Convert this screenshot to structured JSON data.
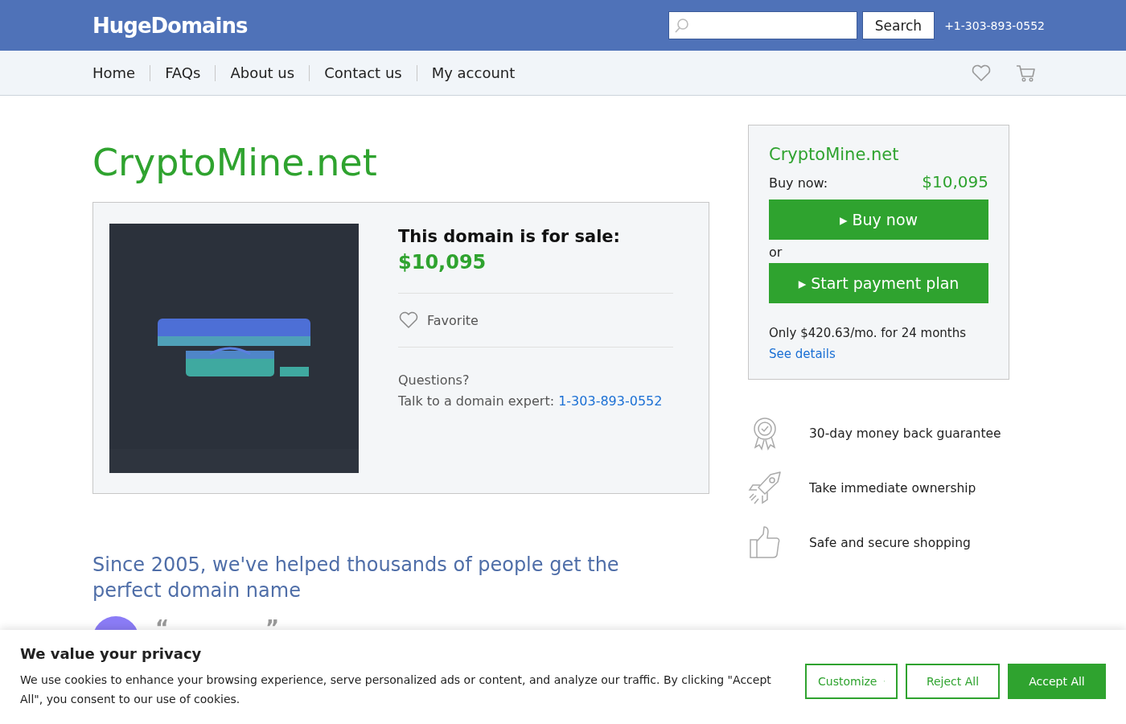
{
  "header": {
    "logo": "HugeDomains",
    "search": {
      "button": "Search"
    },
    "phone": "+1-303-893-0552"
  },
  "nav": {
    "items": [
      {
        "label": "Home"
      },
      {
        "label": "FAQs"
      },
      {
        "label": "About us"
      },
      {
        "label": "Contact us"
      },
      {
        "label": "My account"
      }
    ]
  },
  "domain": {
    "title": "CryptoMine.net",
    "sale_heading": "This domain is for sale:",
    "price": "$10,095",
    "favorite": "Favorite",
    "questions": "Questions?",
    "expert_text": "Talk to a domain expert:",
    "expert_phone": "1-303-893-0552"
  },
  "buy_box": {
    "name": "CryptoMine.net",
    "buy_label": "Buy now:",
    "price": "$10,095",
    "buy_button": "▸ Buy now",
    "or": "or",
    "plan_button": "▸ Start payment plan",
    "plan_text": "Only $420.63/mo. for 24 months",
    "details_link": "See details"
  },
  "features": [
    {
      "kind": "award",
      "text": "30-day money back guarantee"
    },
    {
      "kind": "rocket",
      "text": "Take immediate ownership"
    },
    {
      "kind": "thumb",
      "text": "Safe and secure shopping"
    }
  ],
  "testimonials": {
    "heading": "Since 2005, we've helped thousands of people get the perfect domain name",
    "first": {
      "open_quote": "“",
      "close_quote": "”"
    }
  },
  "cookie_banner": {
    "title": "We value your privacy",
    "text": "We use cookies to enhance your browsing experience, serve personalized ads or content, and analyze our traffic. By clicking \"Accept All\", you consent to our use of cookies.",
    "buttons": [
      {
        "kind": "dropdown",
        "label": "Customize"
      },
      {
        "kind": "outline",
        "label": "Reject All"
      },
      {
        "kind": "primary",
        "label": "Accept All"
      }
    ]
  }
}
